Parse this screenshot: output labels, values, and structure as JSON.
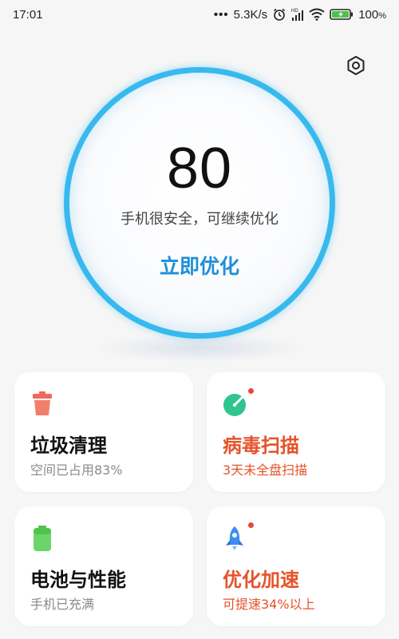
{
  "status_bar": {
    "time": "17:01",
    "dots": "•••",
    "net_speed": "5.3K/s",
    "battery_pct": "100",
    "battery_unit": "%"
  },
  "score": {
    "value": "80",
    "status": "手机很安全，可继续优化",
    "action": "立即优化"
  },
  "cards": {
    "junk": {
      "title": "垃圾清理",
      "subtitle": "空间已占用83%",
      "icon": "trash-icon",
      "icon_color": "#f0685a"
    },
    "virus": {
      "title": "病毒扫描",
      "subtitle": "3天未全盘扫描",
      "icon": "shield-scan-icon",
      "icon_color": "#2ec58e",
      "notification": true
    },
    "battery": {
      "title": "电池与性能",
      "subtitle": "手机已充满",
      "icon": "battery-icon",
      "icon_color": "#6dd46a"
    },
    "speed": {
      "title": "优化加速",
      "subtitle": "可提速34%以上",
      "icon": "rocket-icon",
      "icon_color": "#3c8ef0",
      "notification": true
    }
  },
  "colors": {
    "accent": "#1e8fd8",
    "ring": "#38b9ee",
    "warning": "#e5532b",
    "background": "#f6f6f6"
  }
}
